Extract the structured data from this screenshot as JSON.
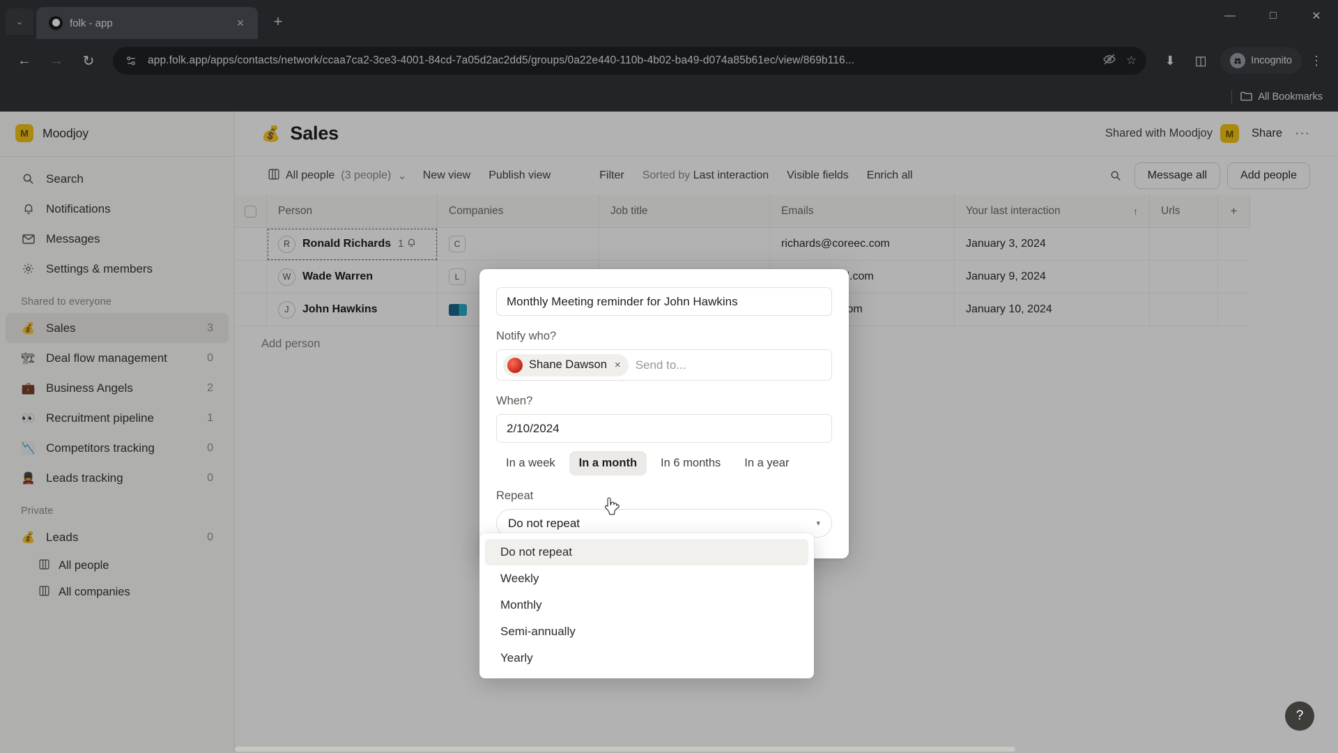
{
  "browser": {
    "tab": {
      "title": "folk - app",
      "favicon": "folk-logo-icon",
      "close": "×"
    },
    "tab_list_chevron": "⌄",
    "new_tab": "+",
    "window": {
      "minimize": "—",
      "maximize": "□",
      "close": "✕"
    },
    "nav": {
      "back": "←",
      "forward": "→",
      "reload": "↻"
    },
    "omnibox": {
      "site_icon": "page-settings-icon",
      "url": "app.folk.app/apps/contacts/network/ccaa7ca2-3ce3-4001-84cd-7a05d2ac2dd5/groups/0a22e440-110b-4b02-ba49-d074a85b61ec/view/869b116...",
      "hide_icon": "👁",
      "bookmark_icon": "☆"
    },
    "toolbar_icons": {
      "download": "⬇",
      "side_panel": "◫"
    },
    "incognito": {
      "label": "Incognito",
      "glyph": "🕵"
    },
    "menu": "⋮",
    "bookmarks": {
      "label": "All Bookmarks",
      "icon": "🗀"
    }
  },
  "sidebar": {
    "workspace": {
      "name": "Moodjoy",
      "avatar_letter": "M"
    },
    "nav": [
      {
        "label": "Search",
        "icon": "search-icon",
        "glyph": "⚲"
      },
      {
        "label": "Notifications",
        "icon": "bell-icon",
        "glyph": "☉"
      },
      {
        "label": "Messages",
        "icon": "mail-icon",
        "glyph": "✉"
      },
      {
        "label": "Settings & members",
        "icon": "gear-icon",
        "glyph": "⚙"
      }
    ],
    "shared_section": "Shared to everyone",
    "shared_items": [
      {
        "label": "Sales",
        "emoji": "💰",
        "count": "3",
        "active": true
      },
      {
        "label": "Deal flow management",
        "emoji": "🏗",
        "count": "0",
        "active": false
      },
      {
        "label": "Business Angels",
        "emoji": "💼",
        "count": "2",
        "active": false
      },
      {
        "label": "Recruitment pipeline",
        "emoji": "👀",
        "count": "1",
        "active": false
      },
      {
        "label": "Competitors tracking",
        "emoji": "📉",
        "count": "0",
        "active": false
      },
      {
        "label": "Leads tracking",
        "emoji": "💂",
        "count": "0",
        "active": false
      }
    ],
    "private_section": "Private",
    "private_items": [
      {
        "label": "Leads",
        "emoji": "💰",
        "count": "0"
      }
    ],
    "private_subitems": [
      {
        "label": "All people",
        "glyph": "▦"
      },
      {
        "label": "All companies",
        "glyph": "▦"
      }
    ]
  },
  "header": {
    "group_emoji": "💰",
    "title": "Sales",
    "shared_with": "Shared with Moodjoy",
    "shared_avatar_letter": "M",
    "share_button": "Share",
    "more_button": "···"
  },
  "view_toolbar": {
    "view_icon": "table-icon",
    "view_name": "All people",
    "view_count": "(3 people)",
    "view_caret": "⌄",
    "new_view": "New view",
    "publish_view": "Publish view",
    "filter": "Filter",
    "sorted_by_prefix": "Sorted by ",
    "sorted_by_value": "Last interaction",
    "visible_fields": "Visible fields",
    "enrich_all": "Enrich all",
    "search_icon": "search-icon",
    "message_all": "Message all",
    "add_people": "Add people"
  },
  "table": {
    "columns": [
      "Person",
      "Companies",
      "Job title",
      "Emails",
      "Your last interaction",
      "Urls"
    ],
    "sort_indicator": "↑",
    "add_column": "+",
    "rows": [
      {
        "initial": "R",
        "person": "Ronald Richards",
        "reminder_count": "1",
        "reminder_icon": "bell-icon",
        "company_badge": "C",
        "email": "richards@coreec.com",
        "last_interaction": "January 3, 2024",
        "selected": true
      },
      {
        "initial": "W",
        "person": "Wade Warren",
        "reminder_count": "",
        "company_badge": "L",
        "email": "wlekki@gmail.com",
        "last_interaction": "January 9, 2024",
        "selected": false
      },
      {
        "initial": "J",
        "person": "John Hawkins",
        "reminder_count": "",
        "company_badge": "logo",
        "email": "ohn@spark.com",
        "last_interaction": "January 10, 2024",
        "selected": false
      }
    ],
    "add_person": "Add person"
  },
  "modal": {
    "title_value": "Monthly Meeting reminder for John Hawkins",
    "notify_label": "Notify who?",
    "token_name": "Shane Dawson",
    "token_remove": "×",
    "notify_placeholder": "Send to...",
    "when_label": "When?",
    "when_value": "2/10/2024",
    "quick_picks": [
      {
        "label": "In a week",
        "selected": false
      },
      {
        "label": "In a month",
        "selected": true
      },
      {
        "label": "In 6 months",
        "selected": false
      },
      {
        "label": "In a year",
        "selected": false
      }
    ],
    "repeat_label": "Repeat",
    "repeat_value": "Do not repeat",
    "repeat_caret": "▾",
    "repeat_options": [
      {
        "label": "Do not repeat",
        "highlighted": true
      },
      {
        "label": "Weekly",
        "highlighted": false
      },
      {
        "label": "Monthly",
        "highlighted": false
      },
      {
        "label": "Semi-annually",
        "highlighted": false
      },
      {
        "label": "Yearly",
        "highlighted": false
      }
    ]
  },
  "help": {
    "label": "?"
  },
  "colors": {
    "accent_yellow": "#f5c518",
    "chrome_dark": "#323639",
    "omnibox_dark": "#202124",
    "sidebar_bg": "#fbfbfa",
    "selected_row": "#eeedea"
  }
}
